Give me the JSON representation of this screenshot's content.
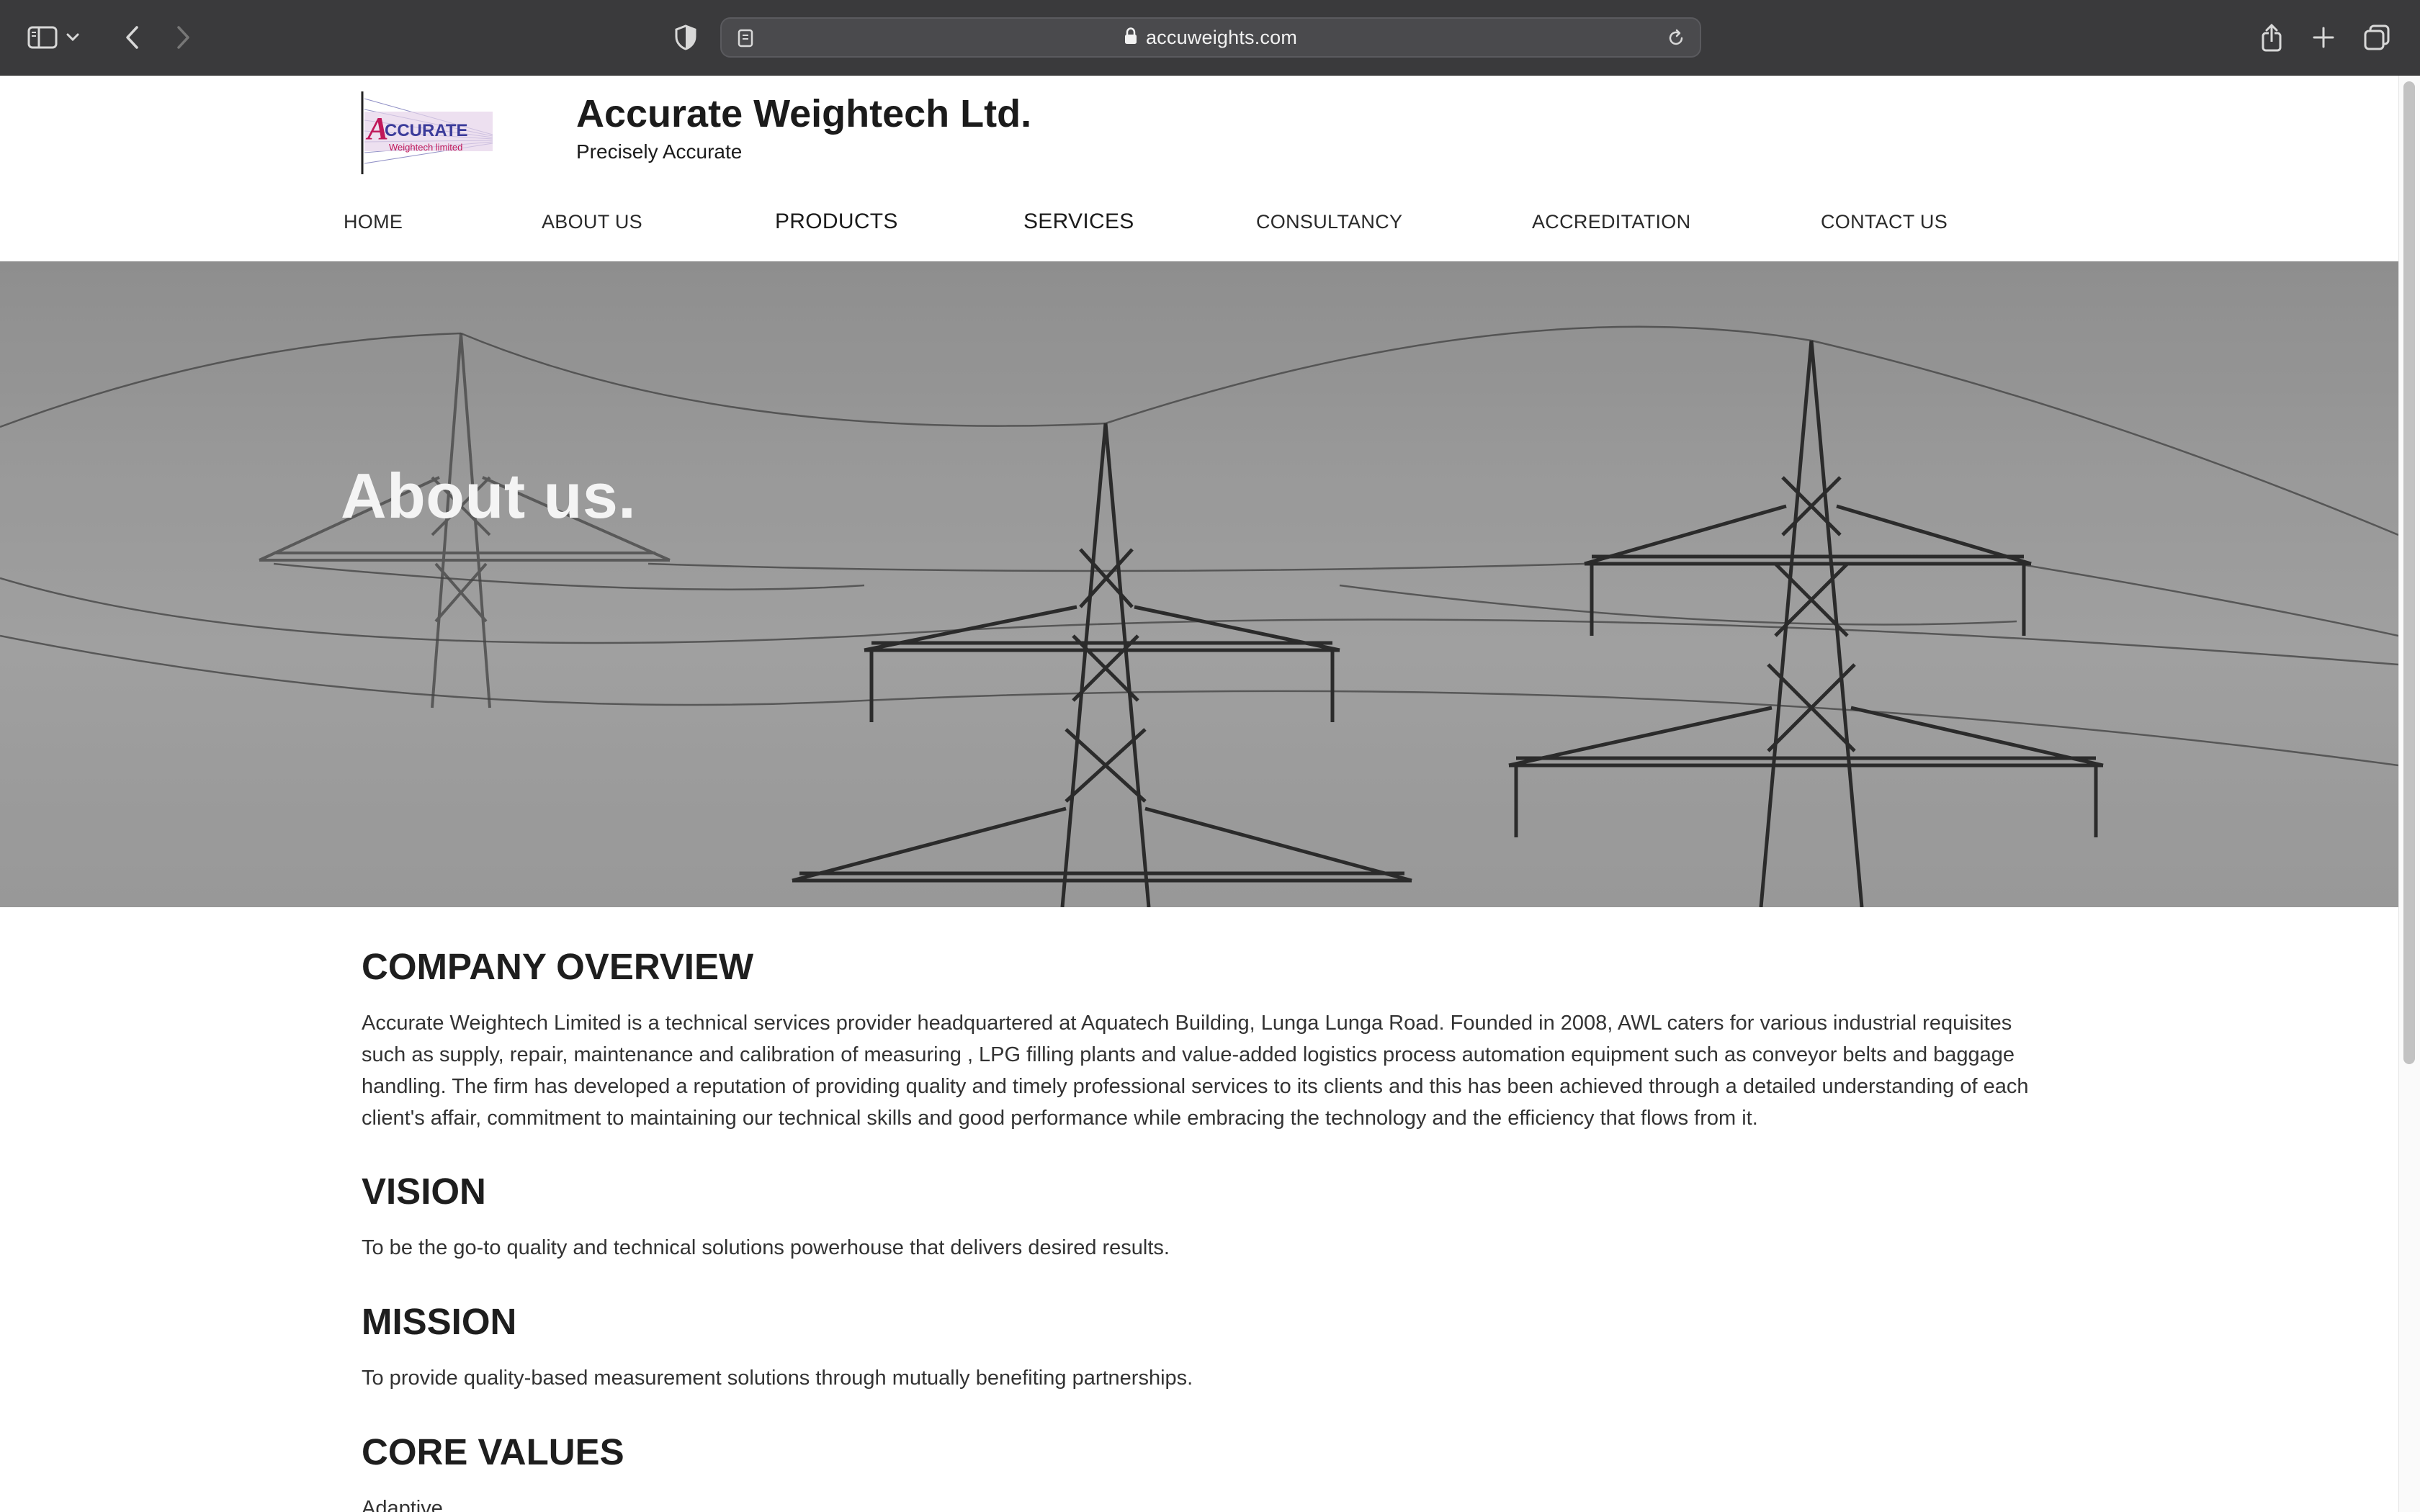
{
  "browser": {
    "url": "accuweights.com"
  },
  "header": {
    "logo_text": "ACCURATE",
    "logo_subtext": "Weightech limited",
    "site_title": "Accurate Weightech Ltd.",
    "tagline": "Precisely Accurate"
  },
  "nav": {
    "items": [
      {
        "label": "HOME"
      },
      {
        "label": "ABOUT US"
      },
      {
        "label": "PRODUCTS"
      },
      {
        "label": "SERVICES"
      },
      {
        "label": "CONSULTANCY"
      },
      {
        "label": "ACCREDITATION"
      },
      {
        "label": "CONTACT US"
      }
    ]
  },
  "hero": {
    "title": "About us."
  },
  "sections": {
    "overview": {
      "title": "COMPANY OVERVIEW",
      "text": "Accurate Weightech Limited is a technical services provider headquartered at Aquatech Building, Lunga Lunga Road. Founded in 2008, AWL caters for various industrial requisites such as supply, repair, maintenance and calibration of measuring , LPG filling plants and value-added logistics process automation equipment such as conveyor belts and baggage handling. The firm has developed a reputation of providing quality and timely professional services to its clients and this has been achieved through a detailed understanding of each client's affair, commitment to maintaining our technical skills and good performance while embracing the technology and the efficiency that flows from it."
    },
    "vision": {
      "title": "VISION",
      "text": "To be the go-to quality and technical solutions powerhouse that delivers desired results."
    },
    "mission": {
      "title": "MISSION",
      "text": "To provide quality-based measurement solutions through mutually benefiting partnerships."
    },
    "core_values": {
      "title": "CORE VALUES",
      "first_value": "Adaptive"
    }
  },
  "colors": {
    "toolbar_bg": "#3a3a3c",
    "hero_overlay": "#9a9a9a",
    "logo_accent": "#c0185a",
    "logo_blue": "#3b3b9a"
  }
}
